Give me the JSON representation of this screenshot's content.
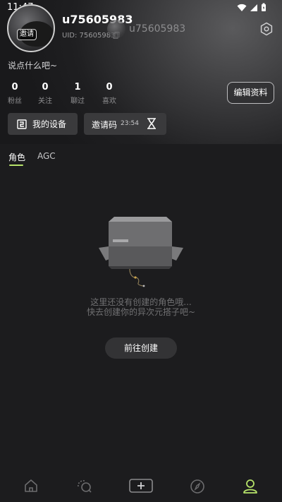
{
  "status_bar": {
    "time": "11:47"
  },
  "profile": {
    "avatar_tag": "邀请",
    "username": "u75605983",
    "uid": "UID: 75605983",
    "secondary_name": "u75605983",
    "bio": "说点什么吧~"
  },
  "stats": [
    {
      "value": "0",
      "label": "粉丝"
    },
    {
      "value": "0",
      "label": "关注"
    },
    {
      "value": "1",
      "label": "聊过"
    },
    {
      "value": "0",
      "label": "喜欢"
    }
  ],
  "buttons": {
    "edit_profile": "编辑资料",
    "my_device": "我的设备",
    "invite_code": "邀请码",
    "invite_timer": "23:54",
    "create": "前往创建"
  },
  "tabs": {
    "active": "角色",
    "inactive": "AGC"
  },
  "empty_state": {
    "line1": "这里还没有创建的角色哦...",
    "line2": "快去创建你的异次元搭子吧~"
  },
  "nav_icons": [
    "home-icon",
    "chat-icon",
    "add-icon",
    "discover-icon",
    "profile-icon"
  ],
  "colors": {
    "accent": "#b6e36a",
    "background": "#1c1c1e"
  }
}
